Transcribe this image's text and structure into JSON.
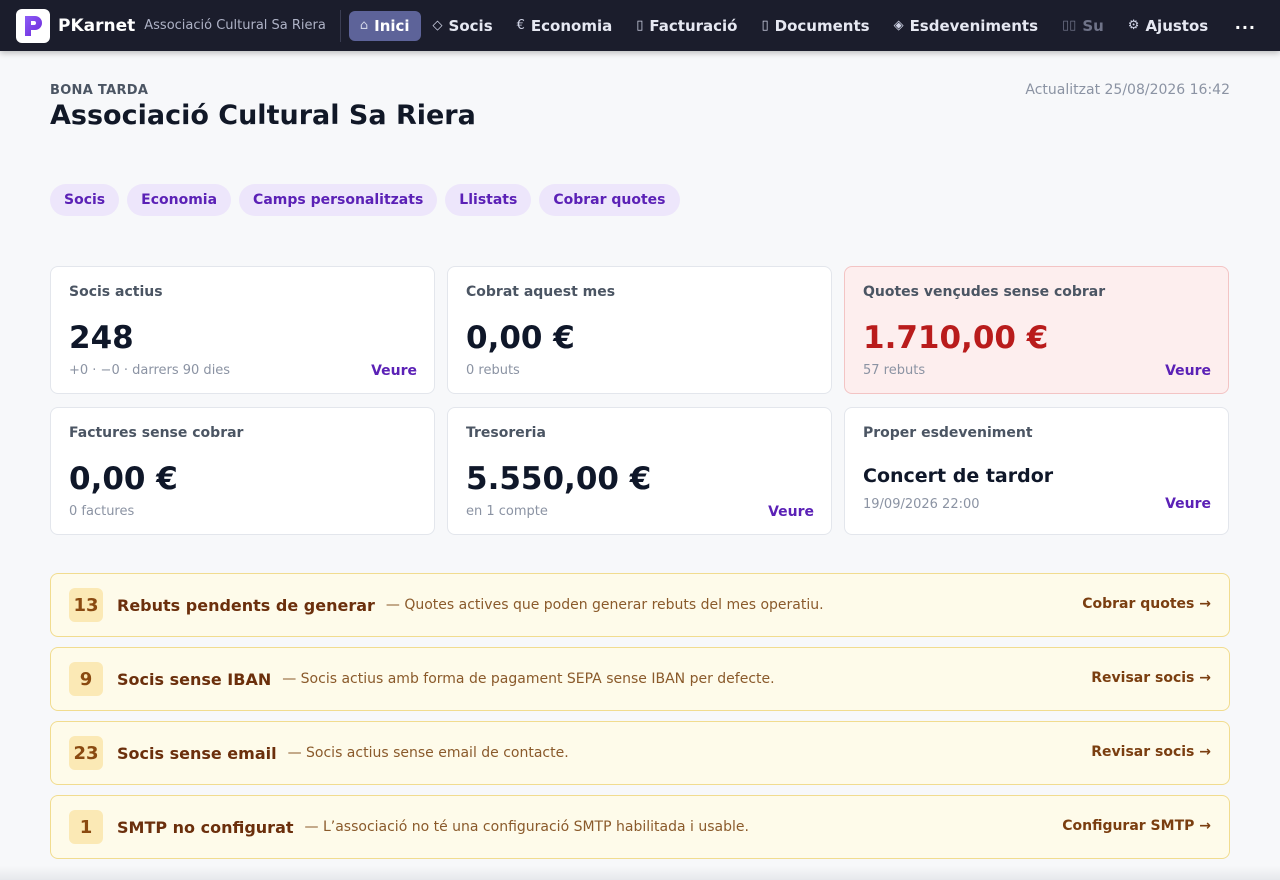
{
  "nav": {
    "brand": "PKarnet",
    "organization": "Associació Cultural Sa Riera",
    "items": [
      {
        "label": "Inici",
        "icon": "home-icon",
        "glyph": "⌂"
      },
      {
        "label": "Socis",
        "icon": "diamond-outline-icon",
        "glyph": "◇"
      },
      {
        "label": "Economia",
        "icon": "euro-icon",
        "glyph": "€"
      },
      {
        "label": "Facturació",
        "icon": "invoice-icon",
        "glyph": "▯"
      },
      {
        "label": "Documents",
        "icon": "document-icon",
        "glyph": "▯"
      },
      {
        "label": "Esdeveniments",
        "icon": "diamond-icon",
        "glyph": "◈"
      },
      {
        "label": "Su",
        "icon": "columns-icon",
        "glyph": "▯▯"
      },
      {
        "label": "Ajustos",
        "icon": "gear-icon",
        "glyph": "⚙"
      }
    ],
    "more": "..."
  },
  "header": {
    "greeting": "BONA TARDA",
    "title": "Associació Cultural Sa Riera",
    "updated": "Actualitzat 25/08/2026 16:42"
  },
  "quick_links": [
    "Socis",
    "Economia",
    "Camps personalitzats",
    "Llistats",
    "Cobrar quotes"
  ],
  "cards": {
    "socis_actius": {
      "label": "Socis actius",
      "value": "248",
      "sub": "+0 · −0 · darrers 90 dies",
      "link": "Veure"
    },
    "cobrat": {
      "label": "Cobrat aquest mes",
      "value": "0,00 €",
      "sub": "0 rebuts"
    },
    "quotes_vencudes": {
      "label": "Quotes vençudes sense cobrar",
      "value": "1.710,00 €",
      "sub": "57 rebuts",
      "link": "Veure"
    },
    "factures": {
      "label": "Factures sense cobrar",
      "value": "0,00 €",
      "sub": "0 factures"
    },
    "tresoreria": {
      "label": "Tresoreria",
      "value": "5.550,00 €",
      "sub": "en 1 compte",
      "link": "Veure"
    },
    "esdeveniment": {
      "label": "Proper esdeveniment",
      "value": "Concert de tardor",
      "sub": "19/09/2026 22:00",
      "link": "Veure"
    }
  },
  "alerts": [
    {
      "count": "13",
      "title": "Rebuts pendents de generar",
      "desc": "— Quotes actives que poden generar rebuts del mes operatiu.",
      "action": "Cobrar quotes →"
    },
    {
      "count": "9",
      "title": "Socis sense IBAN",
      "desc": "— Socis actius amb forma de pagament SEPA sense IBAN per defecte.",
      "action": "Revisar socis →"
    },
    {
      "count": "23",
      "title": "Socis sense email",
      "desc": "— Socis actius sense email de contacte.",
      "action": "Revisar socis →"
    },
    {
      "count": "1",
      "title": "SMTP no configurat",
      "desc": "— L’associació no té una configuració SMTP habilitada i usable.",
      "action": "Configurar SMTP →"
    }
  ],
  "colors": {
    "nav_bg": "#1b1d2c",
    "accent": "#5b21b6",
    "danger": "#b91c1c",
    "warning_bg": "#fefbea"
  }
}
